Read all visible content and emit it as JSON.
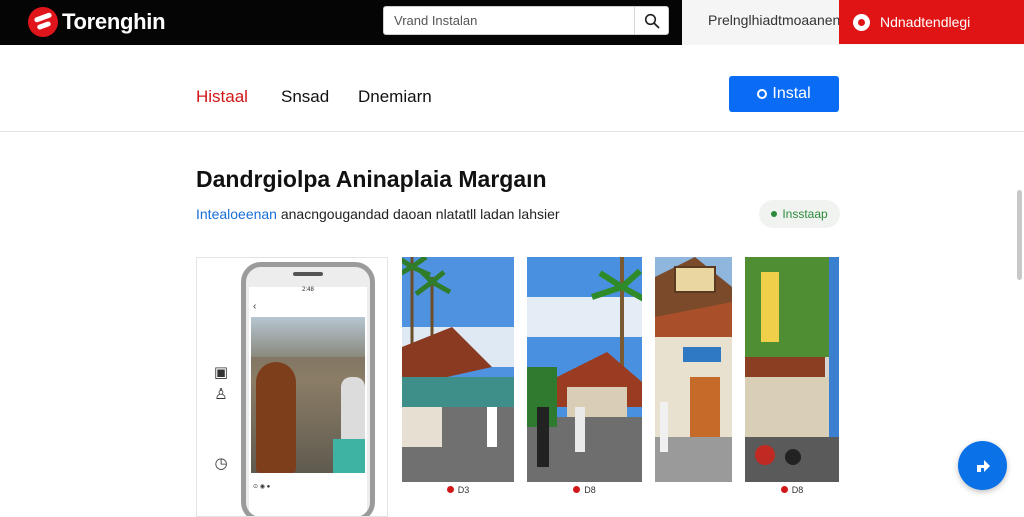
{
  "header": {
    "brand_name": "Torenghin",
    "search_placeholder": "Vrand Instalan",
    "top_link": "Prelnglhiadtmoaanen",
    "cta_label": "Ndnadtendlegi"
  },
  "subnav": {
    "tabs": [
      {
        "label": "Histaal",
        "active": true
      },
      {
        "label": "Snsad",
        "active": false
      },
      {
        "label": "Dnemiarn",
        "active": false
      }
    ],
    "install_label": "Instal"
  },
  "main": {
    "title": "Dandrgiolpa Aninaplaia Margaın",
    "subtitle_link": "Intealoeenan",
    "subtitle_rest": " anacngougandad daoan nlatatll ladan lahsier",
    "chip_label": "Insstaap"
  },
  "phone": {
    "status_text": "2:48",
    "thumbs_text": "⊙ ◉ ●"
  },
  "gallery": {
    "strip1_foot": "D3",
    "strip2_foot": "D8",
    "strip3_foot": "D8"
  },
  "colors": {
    "accent_red": "#e01414",
    "accent_blue": "#0a6cf5",
    "chip_green": "#2a8a3a"
  }
}
